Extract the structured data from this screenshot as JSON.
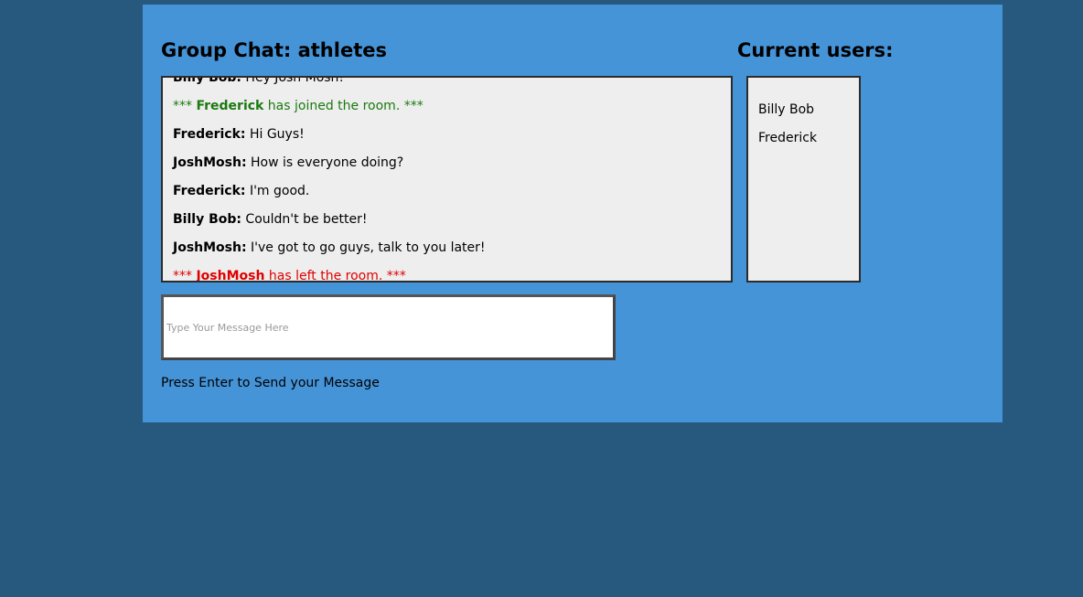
{
  "chat": {
    "title": "Group Chat: athletes",
    "messages": [
      {
        "sender": "Billy Bob:",
        "text": " Hey Josh Mosh!"
      },
      {
        "prefix": "*** ",
        "sender": "Frederick",
        "text": " has joined the room. ***",
        "kind": "join"
      },
      {
        "sender": "Frederick:",
        "text": " Hi Guys!"
      },
      {
        "sender": "JoshMosh:",
        "text": " How is everyone doing?"
      },
      {
        "sender": "Frederick:",
        "text": " I'm good."
      },
      {
        "sender": "Billy Bob:",
        "text": " Couldn't be better!"
      },
      {
        "sender": "JoshMosh:",
        "text": " I've got to go guys, talk to you later!"
      },
      {
        "prefix": "*** ",
        "sender": "JoshMosh",
        "text": " has left the room. ***",
        "kind": "leave"
      }
    ]
  },
  "users": {
    "title": "Current users:",
    "list": [
      "Billy Bob",
      "Frederick"
    ]
  },
  "composer": {
    "placeholder": "Type Your Message Here",
    "value": "",
    "hint": "Press Enter to Send your Message"
  },
  "colors": {
    "page_background": "#27587e",
    "panel_background": "#4694d8",
    "box_background": "#eeeeee",
    "join_message": "#1b7a10",
    "leave_message": "#e00000"
  }
}
